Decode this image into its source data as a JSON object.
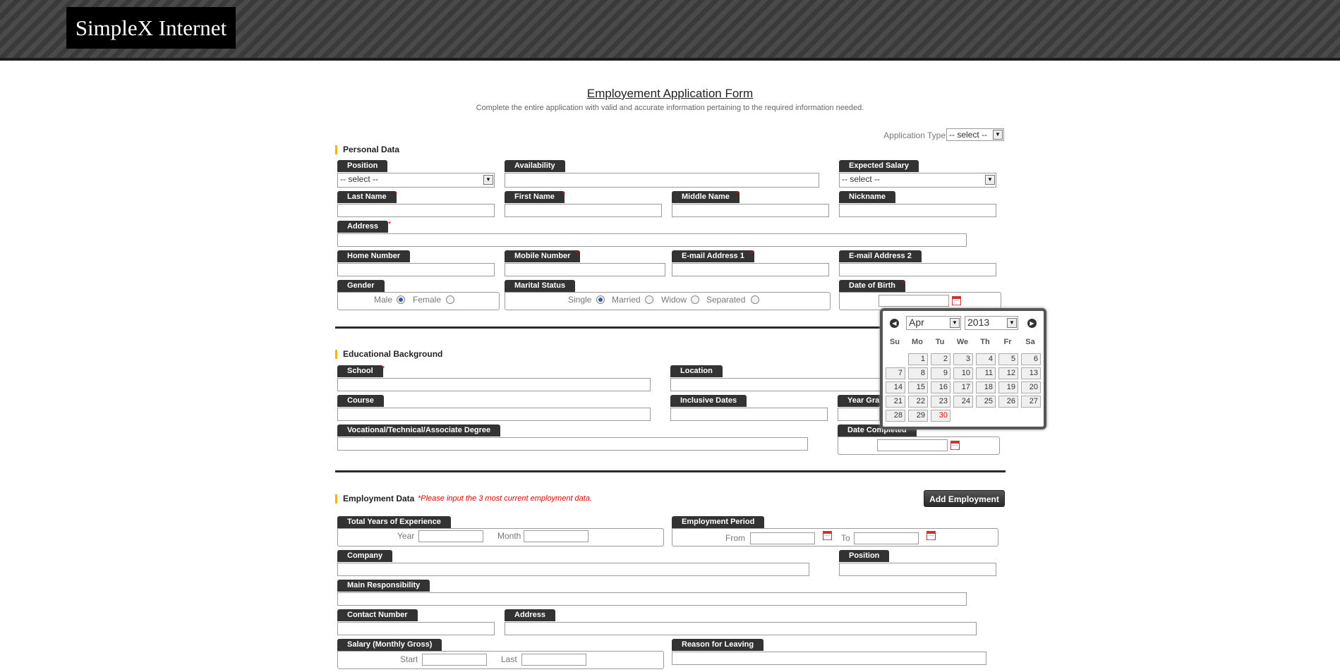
{
  "header": {
    "logo": "SimpleX Internet"
  },
  "form": {
    "title": "Employement Application Form",
    "subtitle": "Complete the entire application with valid and accurate information pertaining to the required information needed.",
    "application_type_label": "Application Type",
    "application_type_value": "-- select --"
  },
  "personal": {
    "section": "Personal Data",
    "position": "Position",
    "position_value": "-- select --",
    "availability": "Availability",
    "expected_salary": "Expected Salary",
    "expected_salary_value": "-- select --",
    "last_name": "Last Name",
    "first_name": "First Name",
    "middle_name": "Middle Name",
    "nickname": "Nickname",
    "address": "Address",
    "home_number": "Home Number",
    "mobile_number": "Mobile Number",
    "email1": "E-mail Address 1",
    "email2": "E-mail Address 2",
    "gender": "Gender",
    "male": "Male",
    "female": "Female",
    "marital_status": "Marital Status",
    "single": "Single",
    "married": "Married",
    "widow": "Widow",
    "separated": "Separated",
    "dob": "Date of Birth",
    "required_mark": "*"
  },
  "education": {
    "section": "Educational Background",
    "school": "School",
    "location": "Location",
    "course": "Course",
    "inclusive_dates": "Inclusive Dates",
    "year_graduated": "Year Gra",
    "vocational": "Vocational/Technical/Associate Degree",
    "date_completed": "Date Completed"
  },
  "employment": {
    "section": "Employment Data",
    "note": "*Please input the 3 most current employment data.",
    "add_button": "Add Employment",
    "total_years": "Total Years of Experience",
    "year": "Year",
    "month": "Month",
    "employment_period": "Employment Period",
    "from": "From",
    "to": "To",
    "company": "Company",
    "position": "Position",
    "main_responsibility": "Main Responsibility",
    "contact_number": "Contact Number",
    "address": "Address",
    "salary": "Salary (Monthly Gross)",
    "start": "Start",
    "last": "Last",
    "reason": "Reason for Leaving"
  },
  "calendar": {
    "month": "Apr",
    "year": "2013",
    "prev": "◀",
    "next": "▶",
    "weekdays": [
      "Su",
      "Mo",
      "Tu",
      "We",
      "Th",
      "Fr",
      "Sa"
    ],
    "days": [
      "1",
      "2",
      "3",
      "4",
      "5",
      "6",
      "7",
      "8",
      "9",
      "10",
      "11",
      "12",
      "13",
      "14",
      "15",
      "16",
      "17",
      "18",
      "19",
      "20",
      "21",
      "22",
      "23",
      "24",
      "25",
      "26",
      "27",
      "28",
      "29",
      "30"
    ],
    "today": "30"
  }
}
